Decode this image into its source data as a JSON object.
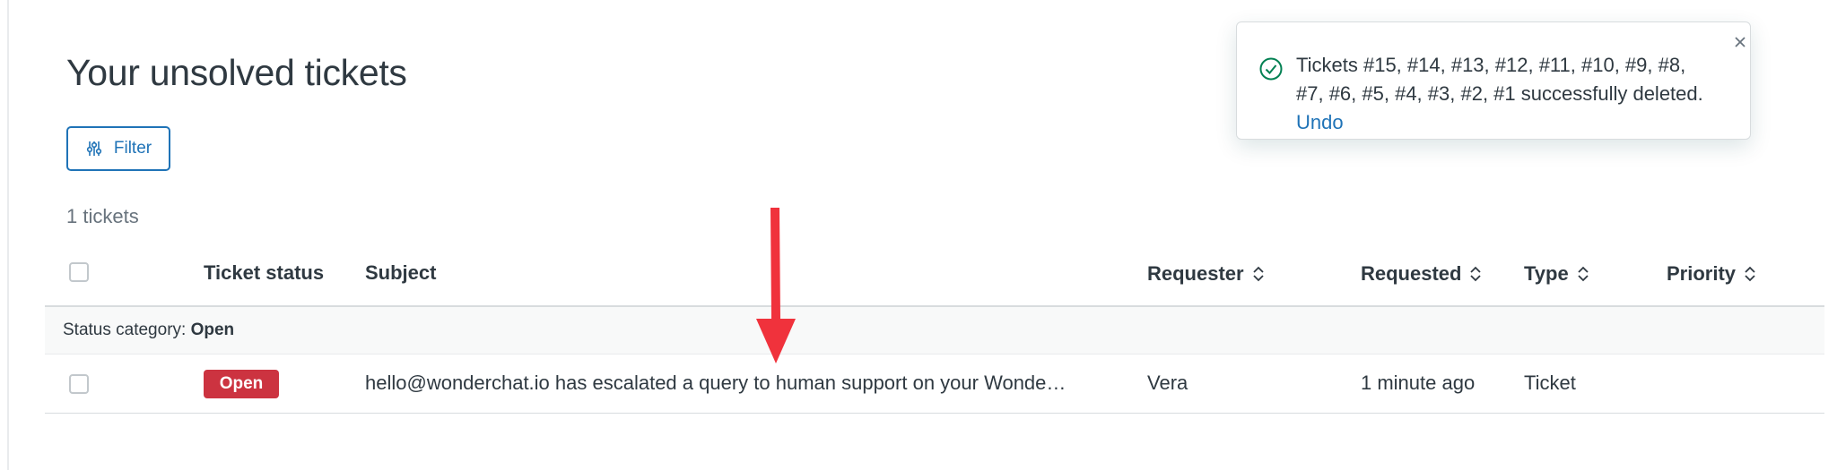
{
  "page": {
    "title": "Your unsolved tickets"
  },
  "toolbar": {
    "filter_label": "Filter",
    "ticket_count": "1 tickets"
  },
  "table": {
    "headers": {
      "status": "Ticket status",
      "subject": "Subject",
      "requester": "Requester",
      "requested": "Requested",
      "type": "Type",
      "priority": "Priority"
    },
    "group": {
      "prefix": "Status category:",
      "value": "Open"
    },
    "rows": [
      {
        "status": "Open",
        "subject": "hello@wonderchat.io has escalated a query to human support on your Wonde…",
        "requester": "Vera",
        "requested": "1 minute ago",
        "type": "Ticket",
        "priority": ""
      }
    ]
  },
  "toast": {
    "message": "Tickets #15, #14, #13, #12, #11, #10, #9, #8, #7, #6, #5, #4, #3, #2, #1 successfully deleted.",
    "undo_label": "Undo"
  },
  "icons": {
    "filter": "sliders-icon",
    "sort": "sort-chevrons-icon",
    "toast_status": "check-circle-icon",
    "toast_close": "close-icon",
    "annotation": "red-arrow-icon"
  },
  "colors": {
    "accent": "#1f73b7",
    "open_badge": "#cc3340",
    "success": "#038153",
    "annotation_arrow": "#f0323c"
  }
}
